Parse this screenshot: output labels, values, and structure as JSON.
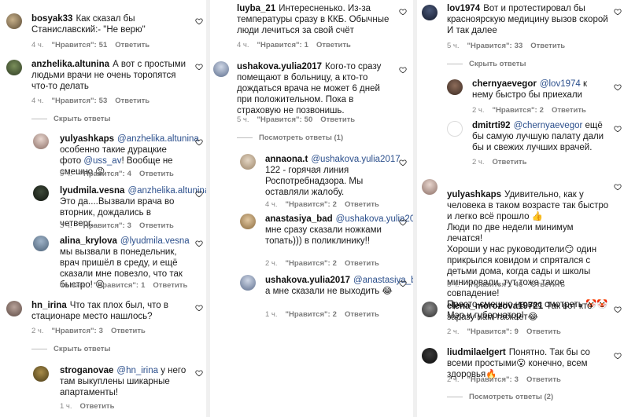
{
  "ui": {
    "like_label": "\"Нравится\":",
    "reply_label": "Ответить",
    "hide_replies": "Скрыть ответы",
    "view_replies_1": "Посмотреть ответы (1)",
    "view_replies_2": "Посмотреть ответы (2)"
  },
  "col1": {
    "c1": {
      "user": "bosyak33",
      "text": "Как сказал бы Станиславский:- \"Не верю\"",
      "time": "4 ч.",
      "likes": "51"
    },
    "c2": {
      "user": "anzhelika.altunina",
      "text": "А вот с простыми людьми врачи не очень торопятся что-то делать",
      "time": "4 ч.",
      "likes": "53"
    },
    "r1": {
      "user": "yulyashkaps",
      "mention": "@anzhelika.altunina",
      "text": "особенно такие дурацкие фото",
      "mention2": "@uss_av",
      "text2": "! Вообще не смешно 😡",
      "time": "3 ч.",
      "likes": "4"
    },
    "r2": {
      "user": "lyudmila.vesna",
      "mention": "@anzhelika.altunina",
      "text": "Это да....Вызвали врача во вторник, дождались в четверг...",
      "time": "3 ч.",
      "likes": "3"
    },
    "r3": {
      "user": "alina_krylova",
      "mention": "@lyudmila.vesna",
      "text": "мы вызвали в понедельник, врач пришёл в среду, и ещё сказали мне повезло, что так быстро! 😔",
      "time": "44 мин.",
      "likes": "1"
    },
    "c3": {
      "user": "hn_irina",
      "text": "Что так плох был, что в стационаре место нашлось?",
      "time": "2 ч.",
      "likes": "3"
    },
    "r4": {
      "user": "stroganovae",
      "mention": "@hn_irina",
      "text": "у него там выкуплены шикарные апартаменты!",
      "time": "1 ч."
    }
  },
  "col2": {
    "c1": {
      "user": "luyba_21",
      "text": "Интересненько. Из-за температуры сразу в ККБ. Обычные люди лечиться за свой счёт",
      "time": "4 ч.",
      "likes": "1"
    },
    "c2": {
      "user": "ushakova.yulia2017",
      "text": "Кого-то сразу помещают в больницу, а кто-то дождаться врача не может 6 дней при положительном. Пока в страховую не позвонишь.",
      "time": "5 ч.",
      "likes": "50"
    },
    "r1": {
      "user": "annaona.t",
      "mention": "@ushakova.yulia2017",
      "text": "122 - горячая линия Роспотребнадзора. Мы оставляли жалобу.",
      "time": "4 ч.",
      "likes": "2"
    },
    "r2": {
      "user": "anastasiya_bad",
      "mention": "@ushakova.yulia2017",
      "text": "мне сразу сказали ножками топать))) в поликлинику!!",
      "time": "2 ч.",
      "likes": "2"
    },
    "r3": {
      "user": "ushakova.yulia2017",
      "mention": "@anastasiya_bad",
      "text": "а мне сказали не выходить 😂",
      "time": "1 ч.",
      "likes": "2"
    }
  },
  "col3": {
    "c1": {
      "user": "lov1974",
      "text": "Вот и протестировал бы красноярскую медицину вызов скорой И так далее",
      "time": "5 ч.",
      "likes": "33"
    },
    "r1": {
      "user": "chernyaevegor",
      "mention": "@lov1974",
      "text": "к нему быстро бы приехали",
      "time": "2 ч.",
      "likes": "2"
    },
    "r2": {
      "user": "dmitrti92",
      "mention": "@chernyaevegor",
      "text": "ещё бы самую лучшую палату дали бы и свежих лучших врачей.",
      "time": "2 ч."
    },
    "c2": {
      "user": "yulyashkaps",
      "text": "Удивительно, как у человека в таком возрасте так быстро и легко всё прошло 👍\nЛюди по две недели минимум лечатся!\nХороши у нас руководители😏 один прикрылся ковидом и спрятался с детьми дома, когда сады и школы минировали, тут тоже такое совпадение!\nПросто смешно на вас смотреть 🤡🤡\nМэр и губернатор!",
      "time": "3 ч.",
      "likes": "46"
    },
    "c3": {
      "user": "elena_morozova19721",
      "text": "Так вот кто заразу нам таскает😂",
      "time": "2 ч.",
      "likes": "9"
    },
    "c4": {
      "user": "liudmilaelgert",
      "text": "Понятно. Так бы со всеми простыми😮 конечно, всем здоровья🔥",
      "time": "2 ч.",
      "likes": "3"
    }
  }
}
